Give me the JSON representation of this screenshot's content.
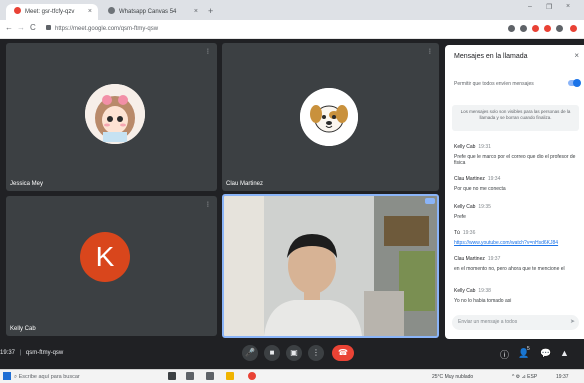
{
  "browser": {
    "tabs": [
      {
        "label": "Meet: gsr-tfcfy-qzv",
        "close": "×"
      },
      {
        "label": "Whatsapp Canvas 54",
        "close": "×"
      }
    ],
    "new_tab": "+",
    "window_controls": {
      "minimize": "–",
      "restore": "❐",
      "close": "×"
    },
    "nav": {
      "back": "←",
      "forward": "→",
      "reload": "C"
    },
    "address": "https://meet.google.com/qsm-ftmy-qsw",
    "extension_colors": [
      "#5f6368",
      "#5f6368",
      "#e94235",
      "#e94235",
      "#5f6368",
      "#e94235"
    ]
  },
  "stage": {
    "tiles": [
      {
        "name": "Jessica Mey",
        "menu": "⋮",
        "avatar": "cartoon-girl"
      },
      {
        "name": "Clau Martinez",
        "menu": "⋮",
        "avatar": "puppy"
      },
      {
        "name": "Kelly Cab",
        "menu": "⋮",
        "avatar_letter": "K"
      },
      {
        "name": "Tú",
        "menu": "⋮",
        "avatar": "camera-video"
      }
    ]
  },
  "chat": {
    "title": "Mensajes en la llamada",
    "close": "×",
    "allow_label": "Permitir que todos envíen mensajes",
    "notice": "Los mensajes solo son visibles para las personas de la llamada y se borran cuando finaliza.",
    "messages": [
      {
        "sender": "Kelly Cab",
        "time": "19:31",
        "text": "Prefe que le marco por el correo que dio el profesor de fisica"
      },
      {
        "sender": "Clau Martinez",
        "time": "19:34",
        "text": "Por que no me conecta"
      },
      {
        "sender": "Kelly Cab",
        "time": "19:35",
        "text": "Prefe"
      },
      {
        "sender": "Tú",
        "time": "19:36",
        "text": "https://www.youtube.com/watch?v=nHsd6KJ84",
        "link": true
      },
      {
        "sender": "Clau Martinez",
        "time": "19:37",
        "text": "en el momento no, pero ahora que te mencione el"
      },
      {
        "sender": "Kelly Cab",
        "time": "19:38",
        "text": "Yo no lo habia tomado asi"
      }
    ],
    "input_placeholder": "Enviar un mensaje a todos",
    "send": "➤"
  },
  "bottom_bar": {
    "time": "19:37",
    "meeting_code": "qsm-ftmy-qsw",
    "controls": {
      "mic": "🎤",
      "camera": "■",
      "present": "▣",
      "more": "⋮",
      "end": "☎"
    },
    "right_icons": {
      "info": "ⓘ",
      "people": "👤",
      "chat": "💬",
      "activities": "▲"
    },
    "people_count": "5"
  },
  "taskbar": {
    "search_placeholder": "Escribe aquí para buscar",
    "weather": "25°C",
    "weather_desc": "Muy nublado",
    "clock": "19:37"
  },
  "colors": {
    "meet_bg": "#202124",
    "tile_bg": "#3c4043",
    "accent": "#1a73e8",
    "end_call": "#ea4335",
    "avatar_k": "#d9461c"
  }
}
